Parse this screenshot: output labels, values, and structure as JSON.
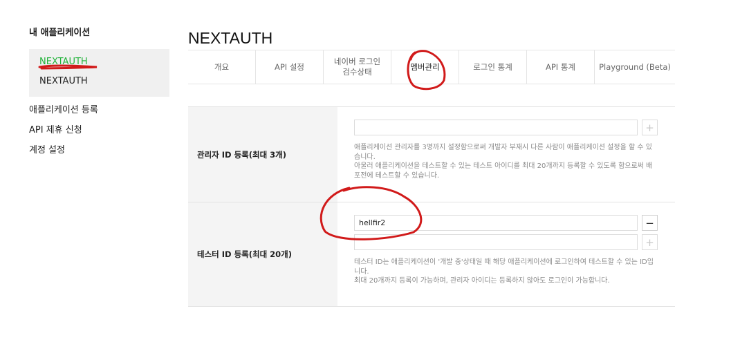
{
  "sidebar": {
    "title": "내 애플리케이션",
    "apps": [
      {
        "label": "NEXTAUTH"
      },
      {
        "label": "NEXTAUTH"
      }
    ],
    "links": [
      {
        "label": "애플리케이션 등록"
      },
      {
        "label": "API 제휴 신청"
      },
      {
        "label": "계정 설정"
      }
    ]
  },
  "main": {
    "title": "NEXTAUTH",
    "tabs": [
      {
        "label": "개요"
      },
      {
        "label": "API 설정"
      },
      {
        "label": "네이버 로그인\n검수상태"
      },
      {
        "label": "멤버관리"
      },
      {
        "label": "로그인 통계"
      },
      {
        "label": "API 통계"
      },
      {
        "label": "Playground (Beta)"
      }
    ],
    "admin": {
      "label": "관리자 ID 등록(최대 3개)",
      "input_value": "",
      "add_symbol": "+",
      "help": [
        "애플리케이션 관리자를 3명까지 설정함으로써 개발자 부재시 다른 사람이 애플리케이션 설정을 할 수 있습니다.",
        "아울러 애플리케이션을 테스트할 수 있는 테스트 아이디를 최대 20개까지 등록할 수 있도록 함으로써 배포전에 테스트할 수 있습니다."
      ]
    },
    "tester": {
      "label": "테스터 ID 등록(최대 20개)",
      "input_values": [
        "hellfir2",
        ""
      ],
      "remove_symbol": "−",
      "add_symbol": "+",
      "help": [
        "테스터 ID는 애플리케이션이 '개발 중'상태일 때 해당 애플리케이션에 로그인하여 테스트할 수 있는 ID입니다.",
        "최대 20개까지 등록이 가능하며, 관리자 아이디는 등록하지 않아도 로그인이 가능합니다."
      ]
    }
  },
  "colors": {
    "active_app": "#20b238",
    "annotation": "#d11a1a"
  }
}
